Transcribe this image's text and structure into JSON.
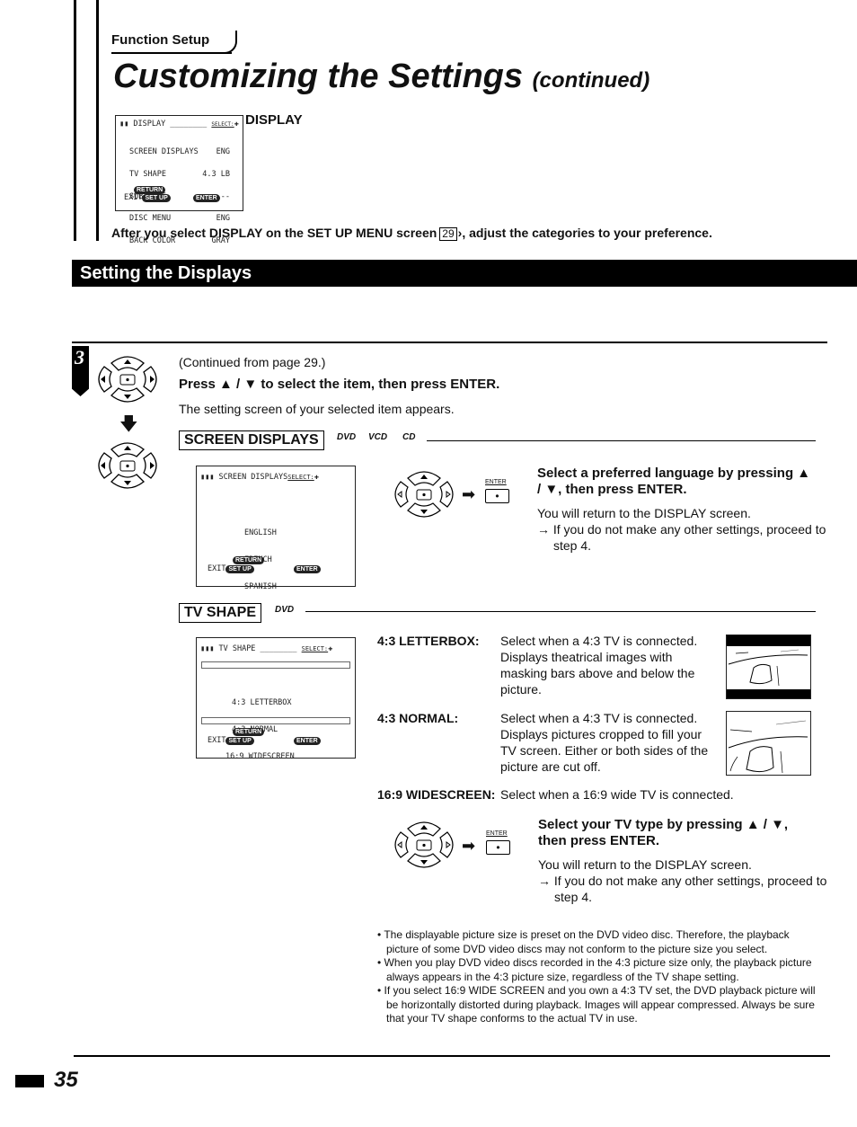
{
  "header": {
    "section_tab": "Function Setup",
    "title": "Customizing the Settings",
    "title_suffix": "(continued)"
  },
  "display_menu": {
    "osd_title": "DISPLAY",
    "osd_select": "SELECT:",
    "items": [
      {
        "label": "SCREEN DISPLAYS",
        "value": "ENG"
      },
      {
        "label": "TV SHAPE",
        "value": "4.3 LB"
      },
      {
        "label": "SUBTITLE",
        "value": "---"
      },
      {
        "label": "DISC MENU",
        "value": "ENG"
      },
      {
        "label": "BACK COLOR",
        "value": "GRAY"
      }
    ],
    "exit_label": "EXIT",
    "return_pill": "RETURN",
    "setup_pill": "SET UP",
    "enter_pill": "ENTER",
    "side_label": "DISPLAY"
  },
  "intro": {
    "before": "After you select DISPLAY on the SET UP MENU screen",
    "page_ref": "29",
    "after": ", adjust the categories to your preference."
  },
  "banner": {
    "title": "Setting the Displays"
  },
  "step3": {
    "number": "3",
    "continued": "(Continued from page 29.)",
    "instruction": "Press ▲ / ▼ to select the item, then press ENTER.",
    "note": "The setting screen of your selected item appears."
  },
  "screen_displays": {
    "heading": "SCREEN DISPLAYS",
    "discs": [
      "DVD",
      "VCD",
      "CD"
    ],
    "osd_title": "SCREEN DISPLAYS",
    "osd_select": "SELECT:",
    "options": [
      "ENGLISH",
      "FRENCH",
      "SPANISH"
    ],
    "exit_label": "EXIT",
    "return_pill": "RETURN",
    "setup_pill": "SET UP",
    "enter_pill": "ENTER",
    "enter_key_label": "ENTER",
    "instruction": "Select a preferred language by pressing ▲ / ▼, then press ENTER.",
    "result": "You will return to the DISPLAY screen.",
    "proceed": "→ If you do not make any other settings, proceed to step 4."
  },
  "tv_shape": {
    "heading": "TV SHAPE",
    "discs": [
      "DVD"
    ],
    "osd_title": "TV SHAPE",
    "osd_select": "SELECT:",
    "options": [
      "4:3 LETTERBOX",
      "4:3 NORMAL",
      "16:9 WIDESCREEN"
    ],
    "exit_label": "EXIT",
    "return_pill": "RETURN",
    "setup_pill": "SET UP",
    "enter_pill": "ENTER",
    "modes": [
      {
        "label": "4:3 LETTERBOX:",
        "desc": "Select when a 4:3 TV is connected. Displays theatrical images with masking bars above and below the picture."
      },
      {
        "label": "4:3 NORMAL:",
        "desc": "Select when a 4:3 TV is connected. Displays pictures cropped to fill your TV screen.  Either or both sides of the picture are cut off."
      },
      {
        "label": "16:9 WIDESCREEN:",
        "desc": "Select when a 16:9 wide TV is connected."
      }
    ],
    "enter_key_label": "ENTER",
    "instruction": "Select your TV type by pressing ▲ / ▼, then press ENTER.",
    "result": "You will return to the DISPLAY screen.",
    "proceed": "→ If you do not make any other settings, proceed to step 4."
  },
  "notes": [
    "The displayable picture size is preset on the DVD video disc. Therefore, the playback picture of some DVD video discs may not conform to the picture size you select.",
    "When you play DVD video discs recorded in the 4:3 picture size only, the playback picture always appears in the 4:3 picture size, regardless of the TV shape setting.",
    "If you select 16:9 WIDE SCREEN and you own a 4:3 TV set, the DVD playback picture will be horizontally distorted during playback. Images will appear compressed.  Always be sure that your TV shape conforms to the actual TV in use."
  ],
  "footer": {
    "page_number": "35"
  }
}
